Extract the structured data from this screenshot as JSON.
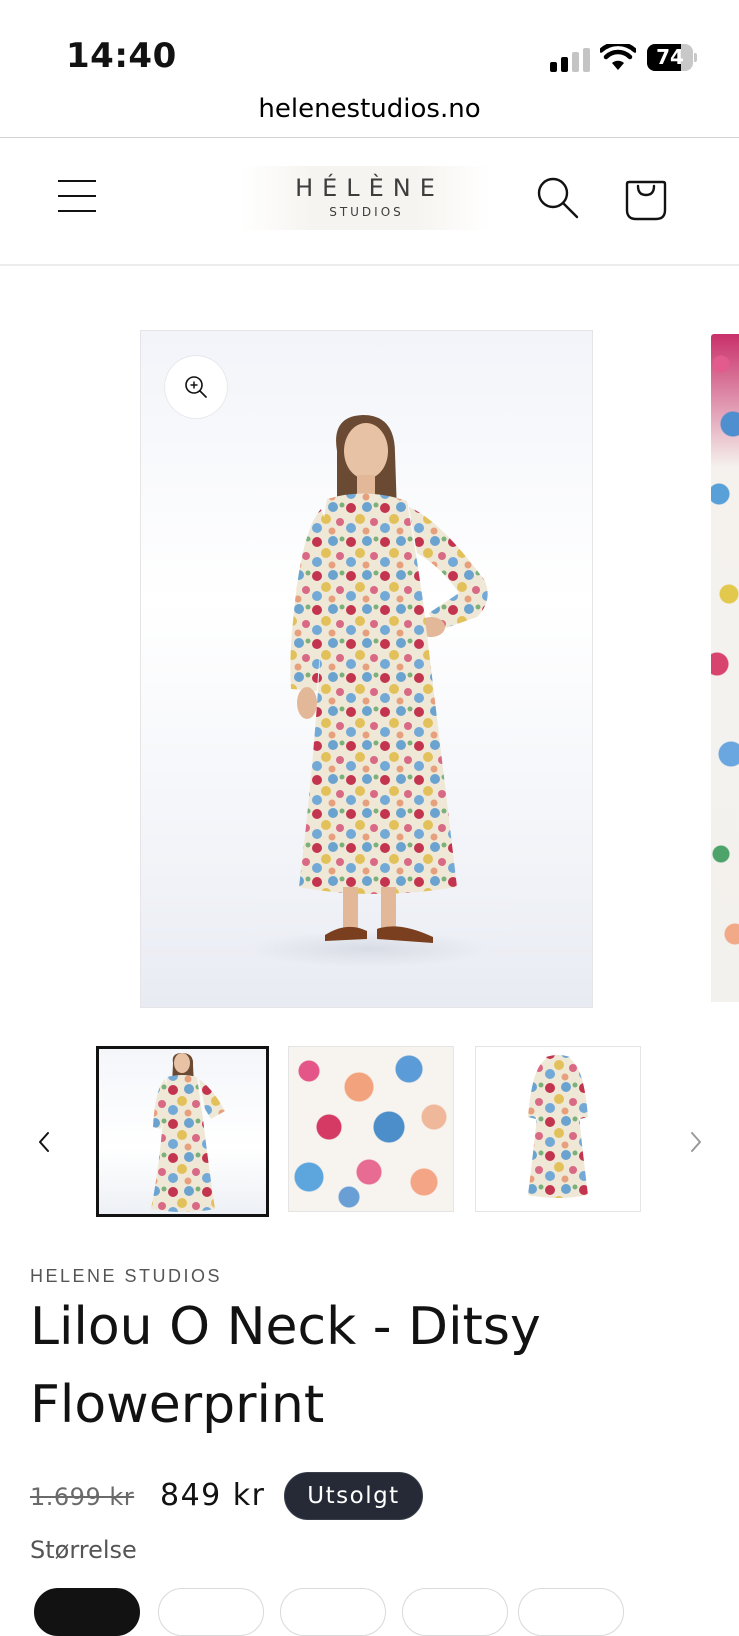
{
  "status_bar": {
    "time": "14:40",
    "battery_percent": "74",
    "battery_level": 0.74,
    "icons": [
      "signal-icon",
      "wifi-icon",
      "battery-icon"
    ]
  },
  "browser": {
    "url": "helenestudios.no"
  },
  "header": {
    "logo_main": "HÉLÈNE",
    "logo_sub": "STUDIOS",
    "icons": [
      "menu-icon",
      "search-icon",
      "cart-icon"
    ]
  },
  "gallery": {
    "icons": [
      "zoom-in-icon",
      "chevron-left-icon",
      "chevron-right-icon"
    ],
    "thumbnail_count": 3,
    "selected_thumbnail": 1
  },
  "product": {
    "vendor": "HELENE STUDIOS",
    "title": "Lilou O Neck - Ditsy Flowerprint",
    "price_regular": "1.699 kr",
    "price_sale": "849 kr",
    "badge": "Utsolgt",
    "size_label": "Størrelse"
  },
  "colors": {
    "text": "#121212",
    "badge_bg": "#252a36",
    "divider": "#d4d4d4"
  }
}
